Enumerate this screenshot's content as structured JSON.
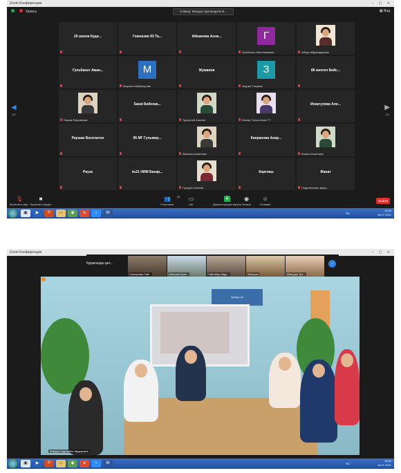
{
  "window": {
    "title": "Zoom Конференция"
  },
  "topbar": {
    "record_label": "Запись",
    "pinned_label": "Спикер: Жандос руководителя...",
    "view_label": "Вид"
  },
  "participants": [
    {
      "name": "20 школа Куди...",
      "sub": ""
    },
    {
      "name": "Гимназия 93 Та...",
      "sub": ""
    },
    {
      "name": "Абжанова Асем...",
      "sub": ""
    },
    {
      "name": "",
      "sub": "Гульбахыт Жантемирова",
      "avatar": "Г",
      "avatar_color": "#8f2a9e"
    },
    {
      "name": "",
      "sub": "Айнур Абдикадырова",
      "photo": true
    },
    {
      "name": "Гульбанат Аман...",
      "sub": ""
    },
    {
      "name": "",
      "sub": "Маржан Абубакирова",
      "avatar": "М",
      "avatar_color": "#2d6fc2"
    },
    {
      "name": "Жуманов",
      "sub": ""
    },
    {
      "name": "",
      "sub": "Заурия Тлеуова",
      "avatar": "З",
      "avatar_color": "#1a9aa6"
    },
    {
      "name": "86 мектеп Бейс...",
      "sub": ""
    },
    {
      "name": "",
      "sub": "Назым Раушанова",
      "photo": true
    },
    {
      "name": "Saeat Бейсека...",
      "sub": ""
    },
    {
      "name": "",
      "sub": "Турсынай Алиева",
      "photo": true
    },
    {
      "name": "",
      "sub": "Жанар Толыгенова ТТ",
      "photo": true
    },
    {
      "name": "Искатулова Але...",
      "sub": ""
    },
    {
      "name": "Раушан Бесплатно",
      "sub": ""
    },
    {
      "name": "95 МГ Гульмир...",
      "sub": ""
    },
    {
      "name": "",
      "sub": "Айгерим Ахметова",
      "photo": true
    },
    {
      "name": "Капранова Анар...",
      "sub": ""
    },
    {
      "name": "",
      "sub": "Жанна Ахметова",
      "photo": true
    },
    {
      "name": "Рауза",
      "sub": ""
    },
    {
      "name": "№21 НИМ Бахар...",
      "sub": ""
    },
    {
      "name": "",
      "sub": "Гульден Алиева",
      "photo": true
    },
    {
      "name": "Карговы",
      "sub": ""
    },
    {
      "name": "Жанат",
      "sub": "Подключение звука..."
    }
  ],
  "page_indicator": {
    "left": "1/2",
    "right": "1/2"
  },
  "toolbar": {
    "mute": "Включить звук",
    "video": "Включить видео",
    "participants": "Участники",
    "participants_count": "42",
    "chat": "Чат",
    "share": "Демонстрация экрана",
    "record": "Запись",
    "reactions": "Реакции",
    "end": "Выйти"
  },
  "clock1": {
    "time": "15:03",
    "date": "18.07.2021"
  },
  "clock2": {
    "time": "15:09",
    "date": "18.07.2021"
  },
  "lang": "RU",
  "window2": {
    "title": "Zoom Конференция"
  },
  "strip": {
    "label": "Қарағанды қал...",
    "thumbs": [
      {
        "name": "Сматулова Тай..."
      },
      {
        "name": "Айгерим Ерек..."
      },
      {
        "name": "Гайсабур Айде..."
      },
      {
        "name": "Айгерим"
      },
      {
        "name": "Айгерим Тул..."
      }
    ]
  },
  "video": {
    "board_text": "Қазақ тілі",
    "caption": "Жандос Нурлыбек Айдаровна"
  }
}
